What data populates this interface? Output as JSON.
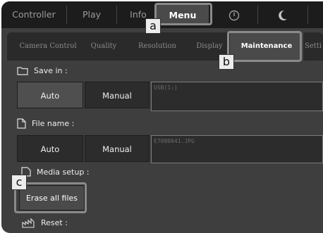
{
  "topnav": {
    "items": [
      {
        "label": "Controller"
      },
      {
        "label": "Play"
      },
      {
        "label": "Info"
      },
      {
        "label": "Menu"
      }
    ],
    "active": "Menu"
  },
  "subtabs": {
    "items": [
      {
        "label": "Camera Control"
      },
      {
        "label": "Quality"
      },
      {
        "label": "Resolution"
      },
      {
        "label": "Display"
      },
      {
        "label": "Maintenance"
      },
      {
        "label": "Setti"
      }
    ],
    "active": "Maintenance"
  },
  "save_in": {
    "label": "Save in :",
    "auto_label": "Auto",
    "manual_label": "Manual",
    "selected": "Auto",
    "path_value": "USB(1:)"
  },
  "file_name": {
    "label": "File name :",
    "auto_label": "Auto",
    "manual_label": "Manual",
    "value": "E7080041.JPG"
  },
  "media_setup": {
    "label": "Media setup :",
    "erase_label": "Erase all files"
  },
  "reset": {
    "label": "Reset :"
  },
  "callouts": {
    "a": "a",
    "b": "b",
    "c": "c"
  }
}
